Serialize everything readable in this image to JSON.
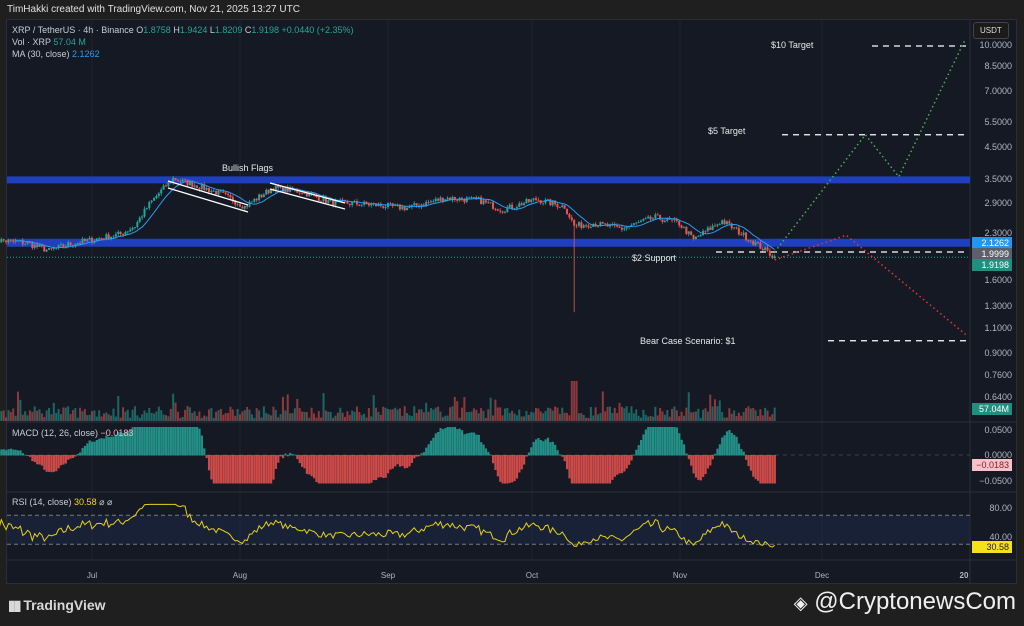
{
  "credit": "TimHakki created with TradingView.com, Nov 21, 2025 13:27 UTC",
  "legend": {
    "symbol": "XRP / TetherUS · 4h · Binance",
    "o_label": "O",
    "o": "1.8758",
    "h_label": "H",
    "h": "1.9424",
    "l_label": "L",
    "l": "1.8209",
    "c_label": "C",
    "c": "1.9198",
    "change": "+0.0440 (+2.35%)",
    "vol_label": "Vol · XRP",
    "vol": "57.04 M",
    "ma_label": "MA (30, close)",
    "ma": "2.1262",
    "macd_label": "MACD (12, 26, close)",
    "macd": "−0.0183",
    "rsi_label": "RSI (14, close)",
    "rsi": "30.58",
    "rsi_icons": "⌀ ⌀"
  },
  "currency_button": "USDT",
  "price_axis": [
    "10.0000",
    "8.5000",
    "7.0000",
    "5.5000",
    "4.5000",
    "3.5000",
    "2.9000",
    "2.3000",
    "1.6000",
    "1.3000",
    "1.1000",
    "0.9000",
    "0.7600",
    "0.6400"
  ],
  "price_badges": {
    "ma": "2.1262",
    "support": "1.9999",
    "last": "1.9198",
    "volume": "57.04M"
  },
  "macd_axis": [
    "0.0500",
    "0.0000",
    "−0.0500"
  ],
  "macd_badge": "−0.0183",
  "rsi_axis": [
    "80.00",
    "40.00"
  ],
  "rsi_badge": "30.58",
  "time_axis": [
    "Jul",
    "Aug",
    "Sep",
    "Oct",
    "Nov",
    "Dec",
    "20"
  ],
  "annotations": {
    "target10": "$10 Target",
    "target5": "$5 Target",
    "flags": "Bullish Flags",
    "support": "$2 Support",
    "bear": "Bear Case Scenario: $1"
  },
  "footer": {
    "brand": "TradingView",
    "watermark": "@CryptonewsCom"
  },
  "colors": {
    "up": "#26a69a",
    "down": "#ef5350",
    "ma": "#2d9cf0",
    "band": "#1f3fbf",
    "rsi": "#e6d21a",
    "bull_path": "#4caf50",
    "bear_path": "#e53935"
  },
  "chart_data": {
    "type": "candlestick",
    "title": "XRP / TetherUS · 4h · Binance",
    "scale": "log",
    "ylim": [
      0.62,
      11
    ],
    "price_path": [
      [
        "2025-06-10",
        2.2
      ],
      [
        "2025-06-17",
        2.15
      ],
      [
        "2025-06-22",
        2.02
      ],
      [
        "2025-06-26",
        2.12
      ],
      [
        "2025-07-01",
        2.2
      ],
      [
        "2025-07-07",
        2.3
      ],
      [
        "2025-07-10",
        2.45
      ],
      [
        "2025-07-13",
        2.9
      ],
      [
        "2025-07-18",
        3.55
      ],
      [
        "2025-07-22",
        3.4
      ],
      [
        "2025-07-28",
        3.15
      ],
      [
        "2025-08-02",
        2.85
      ],
      [
        "2025-08-08",
        3.3
      ],
      [
        "2025-08-14",
        3.2
      ],
      [
        "2025-08-20",
        2.95
      ],
      [
        "2025-08-28",
        2.9
      ],
      [
        "2025-09-05",
        2.82
      ],
      [
        "2025-09-13",
        3.05
      ],
      [
        "2025-09-20",
        3.0
      ],
      [
        "2025-09-25",
        2.78
      ],
      [
        "2025-10-02",
        3.02
      ],
      [
        "2025-10-08",
        2.85
      ],
      [
        "2025-10-10",
        2.45
      ],
      [
        "2025-10-14",
        2.5
      ],
      [
        "2025-10-20",
        2.4
      ],
      [
        "2025-10-27",
        2.62
      ],
      [
        "2025-11-01",
        2.5
      ],
      [
        "2025-11-04",
        2.2
      ],
      [
        "2025-11-10",
        2.55
      ],
      [
        "2025-11-15",
        2.25
      ],
      [
        "2025-11-21",
        1.92
      ]
    ],
    "flash_crash": {
      "date": "2025-10-10",
      "low": 1.25
    },
    "horizontal_bands": [
      3.5,
      2.15
    ],
    "levels": [
      {
        "label": "$10 Target",
        "value": 10.0
      },
      {
        "label": "$5 Target",
        "value": 5.0
      },
      {
        "label": "$2 Support",
        "value": 2.0
      },
      {
        "label": "Bear Case Scenario: $1",
        "value": 1.0
      }
    ],
    "bull_projection": [
      [
        "2025-11-21",
        2.0
      ],
      [
        "2025-12-10",
        5.0
      ],
      [
        "2025-12-17",
        3.6
      ],
      [
        "2025-12-31",
        10.6
      ]
    ],
    "bear_projection": [
      [
        "2025-11-21",
        1.88
      ],
      [
        "2025-12-06",
        2.28
      ],
      [
        "2025-12-31",
        1.05
      ]
    ],
    "ma_period": 30,
    "macd": {
      "fast": 12,
      "slow": 26,
      "last": -0.0183,
      "ylim": [
        -0.07,
        0.07
      ]
    },
    "rsi": {
      "period": 14,
      "last": 30.58,
      "bands": [
        70,
        30
      ]
    },
    "volume_last": "57.04M"
  }
}
